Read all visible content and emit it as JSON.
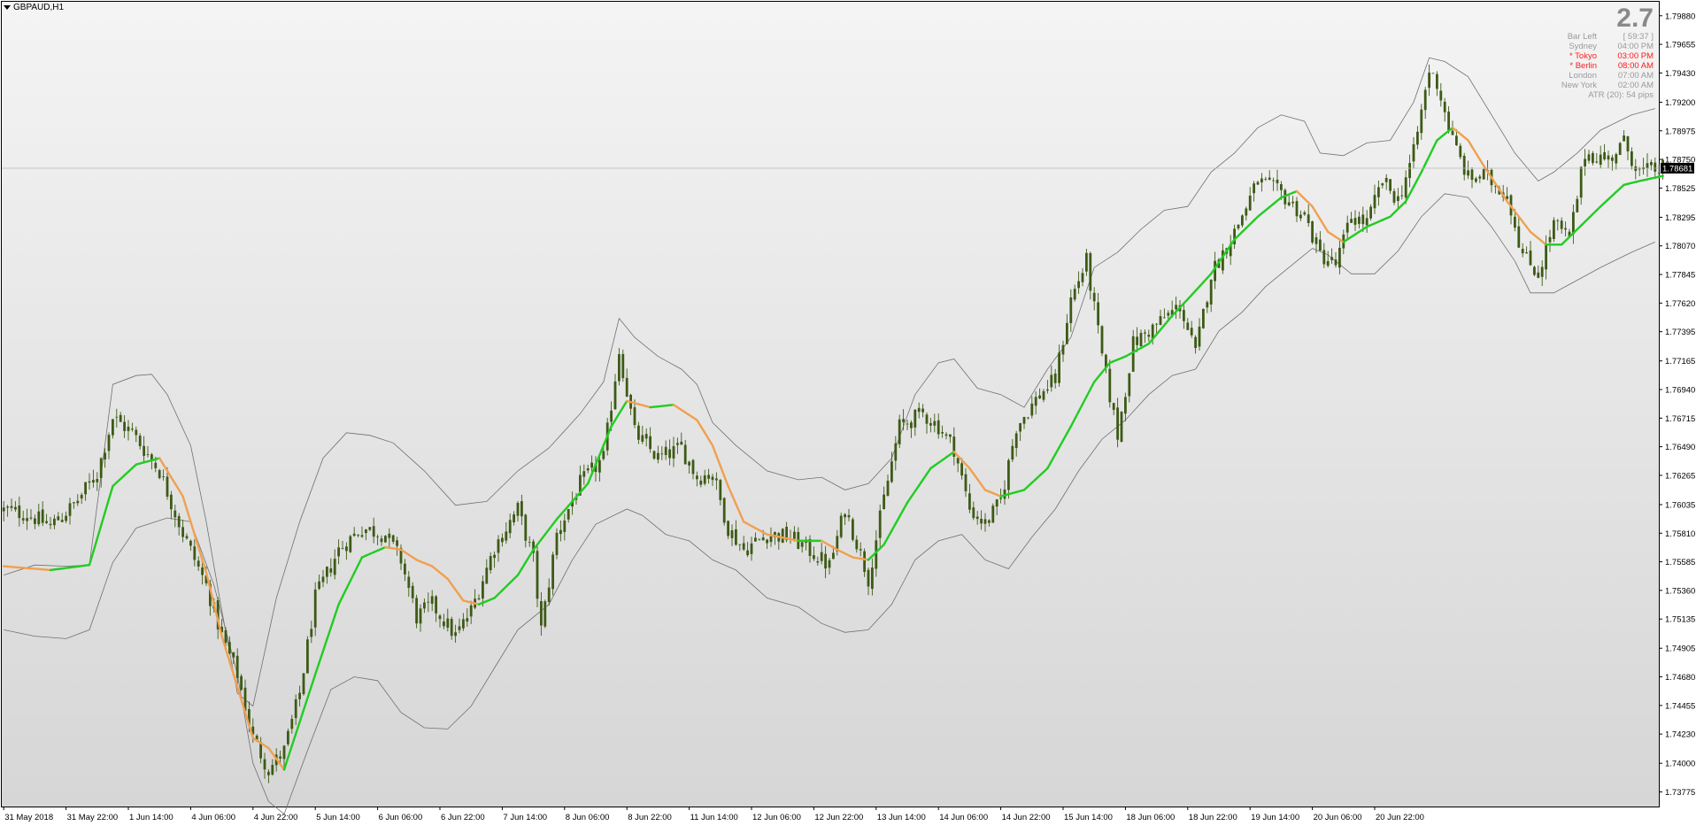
{
  "window": {
    "title": "GBPAUD,H1"
  },
  "info_panel": {
    "big_value": "2.7",
    "rows": [
      {
        "label": "Bar Left",
        "value": "[ 59:37 ]",
        "highlight": false
      },
      {
        "label": "Sydney",
        "value": "04:00 PM",
        "highlight": false
      },
      {
        "label": "* Tokyo",
        "value": "03:00 PM",
        "highlight": true
      },
      {
        "label": "* Berlin",
        "value": "08:00 AM",
        "highlight": true
      },
      {
        "label": "London",
        "value": "07:00 AM",
        "highlight": false
      },
      {
        "label": "New York",
        "value": "02:00 AM",
        "highlight": false
      }
    ],
    "atr": "ATR (20): 54 pips"
  },
  "colors": {
    "bg_top": "#f4f4f4",
    "bg_bottom": "#d6d6d6",
    "candle": "#3d5a16",
    "ma_up": "#22cc22",
    "ma_down": "#f0a050",
    "band": "#707070",
    "current_price_bg": "#000000"
  },
  "price_axis": {
    "labels": [
      "1.79880",
      "1.79655",
      "1.79430",
      "1.79200",
      "1.78975",
      "1.78750",
      "1.78525",
      "1.78295",
      "1.78070",
      "1.77845",
      "1.77620",
      "1.77395",
      "1.77165",
      "1.76940",
      "1.76715",
      "1.76490",
      "1.76265",
      "1.76035",
      "1.75810",
      "1.75585",
      "1.75360",
      "1.75135",
      "1.74905",
      "1.74680",
      "1.74455",
      "1.74230",
      "1.74000",
      "1.73775"
    ],
    "current_price": "1.78681"
  },
  "time_axis": {
    "labels": [
      "31 May 2018",
      "31 May 22:00",
      "1 Jun 14:00",
      "4 Jun 06:00",
      "4 Jun 22:00",
      "5 Jun 14:00",
      "6 Jun 06:00",
      "6 Jun 22:00",
      "7 Jun 14:00",
      "8 Jun 06:00",
      "8 Jun 22:00",
      "11 Jun 14:00",
      "12 Jun 06:00",
      "12 Jun 22:00",
      "13 Jun 14:00",
      "14 Jun 06:00",
      "14 Jun 22:00",
      "15 Jun 14:00",
      "18 Jun 06:00",
      "18 Jun 22:00",
      "19 Jun 14:00",
      "20 Jun 06:00",
      "20 Jun 22:00"
    ]
  },
  "chart_data": {
    "type": "candlestick",
    "symbol": "GBPAUD",
    "timeframe": "H1",
    "ylim": [
      1.7366,
      1.7999
    ],
    "current_price": 1.78681,
    "close_path": [
      [
        0,
        1.7599
      ],
      [
        6,
        1.7596
      ],
      [
        12,
        1.7587
      ],
      [
        18,
        1.7603
      ],
      [
        24,
        1.7628
      ],
      [
        28,
        1.7672
      ],
      [
        33,
        1.766
      ],
      [
        40,
        1.763
      ],
      [
        46,
        1.7581
      ],
      [
        52,
        1.754
      ],
      [
        56,
        1.75
      ],
      [
        60,
        1.747
      ],
      [
        64,
        1.742
      ],
      [
        68,
        1.7395
      ],
      [
        72,
        1.741
      ],
      [
        76,
        1.7455
      ],
      [
        80,
        1.753
      ],
      [
        86,
        1.7568
      ],
      [
        92,
        1.7585
      ],
      [
        98,
        1.758
      ],
      [
        102,
        1.756
      ],
      [
        106,
        1.7515
      ],
      [
        110,
        1.7525
      ],
      [
        116,
        1.75
      ],
      [
        120,
        1.752
      ],
      [
        126,
        1.757
      ],
      [
        132,
        1.76
      ],
      [
        136,
        1.756
      ],
      [
        138,
        1.7505
      ],
      [
        142,
        1.758
      ],
      [
        148,
        1.762
      ],
      [
        154,
        1.764
      ],
      [
        158,
        1.7725
      ],
      [
        162,
        1.766
      ],
      [
        168,
        1.764
      ],
      [
        174,
        1.7648
      ],
      [
        178,
        1.7625
      ],
      [
        182,
        1.7628
      ],
      [
        186,
        1.7585
      ],
      [
        190,
        1.7568
      ],
      [
        196,
        1.758
      ],
      [
        202,
        1.7578
      ],
      [
        208,
        1.7565
      ],
      [
        212,
        1.7555
      ],
      [
        216,
        1.76
      ],
      [
        220,
        1.7565
      ],
      [
        222,
        1.7545
      ],
      [
        226,
        1.7608
      ],
      [
        230,
        1.7665
      ],
      [
        236,
        1.7675
      ],
      [
        240,
        1.7665
      ],
      [
        244,
        1.7648
      ],
      [
        248,
        1.76
      ],
      [
        252,
        1.7588
      ],
      [
        256,
        1.7606
      ],
      [
        260,
        1.7665
      ],
      [
        266,
        1.769
      ],
      [
        270,
        1.7702
      ],
      [
        274,
        1.7765
      ],
      [
        278,
        1.7795
      ],
      [
        282,
        1.772
      ],
      [
        286,
        1.7658
      ],
      [
        290,
        1.773
      ],
      [
        296,
        1.7745
      ],
      [
        302,
        1.776
      ],
      [
        306,
        1.7722
      ],
      [
        310,
        1.7785
      ],
      [
        316,
        1.7818
      ],
      [
        322,
        1.7858
      ],
      [
        328,
        1.7848
      ],
      [
        334,
        1.783
      ],
      [
        338,
        1.78
      ],
      [
        342,
        1.7792
      ],
      [
        346,
        1.783
      ],
      [
        350,
        1.7825
      ],
      [
        354,
        1.7858
      ],
      [
        358,
        1.7843
      ],
      [
        362,
        1.788
      ],
      [
        366,
        1.7945
      ],
      [
        368,
        1.7935
      ],
      [
        372,
        1.789
      ],
      [
        376,
        1.786
      ],
      [
        380,
        1.7862
      ],
      [
        386,
        1.7848
      ],
      [
        390,
        1.78
      ],
      [
        394,
        1.7785
      ],
      [
        398,
        1.7825
      ],
      [
        402,
        1.7812
      ],
      [
        406,
        1.788
      ],
      [
        412,
        1.7875
      ],
      [
        416,
        1.7888
      ],
      [
        420,
        1.7865
      ],
      [
        426,
        1.7868
      ]
    ],
    "ma_path": [
      [
        0,
        1.7555
      ],
      [
        12,
        1.7552
      ],
      [
        22,
        1.7556
      ],
      [
        28,
        1.7618
      ],
      [
        34,
        1.7635
      ],
      [
        40,
        1.764
      ],
      [
        46,
        1.761
      ],
      [
        52,
        1.755
      ],
      [
        56,
        1.75
      ],
      [
        60,
        1.746
      ],
      [
        64,
        1.742
      ],
      [
        68,
        1.7412
      ],
      [
        72,
        1.7395
      ],
      [
        80,
        1.747
      ],
      [
        86,
        1.7525
      ],
      [
        92,
        1.7562
      ],
      [
        98,
        1.757
      ],
      [
        102,
        1.7568
      ],
      [
        106,
        1.756
      ],
      [
        110,
        1.7555
      ],
      [
        114,
        1.7545
      ],
      [
        118,
        1.7528
      ],
      [
        122,
        1.7525
      ],
      [
        126,
        1.753
      ],
      [
        132,
        1.7548
      ],
      [
        136,
        1.7568
      ],
      [
        142,
        1.7592
      ],
      [
        150,
        1.762
      ],
      [
        156,
        1.7665
      ],
      [
        160,
        1.7685
      ],
      [
        166,
        1.768
      ],
      [
        172,
        1.7682
      ],
      [
        178,
        1.767
      ],
      [
        182,
        1.765
      ],
      [
        186,
        1.7618
      ],
      [
        190,
        1.759
      ],
      [
        196,
        1.758
      ],
      [
        204,
        1.7575
      ],
      [
        210,
        1.7575
      ],
      [
        214,
        1.7568
      ],
      [
        218,
        1.7562
      ],
      [
        222,
        1.756
      ],
      [
        226,
        1.7572
      ],
      [
        232,
        1.7605
      ],
      [
        238,
        1.7632
      ],
      [
        244,
        1.7645
      ],
      [
        248,
        1.7632
      ],
      [
        252,
        1.7615
      ],
      [
        256,
        1.761
      ],
      [
        262,
        1.7615
      ],
      [
        268,
        1.7632
      ],
      [
        274,
        1.7665
      ],
      [
        280,
        1.77
      ],
      [
        284,
        1.7715
      ],
      [
        288,
        1.772
      ],
      [
        294,
        1.773
      ],
      [
        300,
        1.7752
      ],
      [
        304,
        1.7765
      ],
      [
        310,
        1.7785
      ],
      [
        316,
        1.7812
      ],
      [
        322,
        1.783
      ],
      [
        328,
        1.7845
      ],
      [
        332,
        1.785
      ],
      [
        336,
        1.7838
      ],
      [
        340,
        1.7818
      ],
      [
        344,
        1.781
      ],
      [
        350,
        1.7822
      ],
      [
        356,
        1.783
      ],
      [
        360,
        1.7842
      ],
      [
        364,
        1.7865
      ],
      [
        368,
        1.789
      ],
      [
        372,
        1.79
      ],
      [
        376,
        1.789
      ],
      [
        380,
        1.787
      ],
      [
        386,
        1.7842
      ],
      [
        392,
        1.7818
      ],
      [
        396,
        1.7808
      ],
      [
        400,
        1.7808
      ],
      [
        404,
        1.782
      ],
      [
        410,
        1.7838
      ],
      [
        416,
        1.7855
      ],
      [
        420,
        1.7858
      ],
      [
        426,
        1.7862
      ]
    ],
    "band_upper_path": [
      [
        0,
        1.7548
      ],
      [
        8,
        1.7556
      ],
      [
        16,
        1.7555
      ],
      [
        22,
        1.7556
      ],
      [
        28,
        1.7698
      ],
      [
        34,
        1.7705
      ],
      [
        38,
        1.7706
      ],
      [
        42,
        1.769
      ],
      [
        48,
        1.765
      ],
      [
        52,
        1.759
      ],
      [
        56,
        1.752
      ],
      [
        60,
        1.7455
      ],
      [
        64,
        1.7445
      ],
      [
        70,
        1.753
      ],
      [
        76,
        1.759
      ],
      [
        82,
        1.764
      ],
      [
        88,
        1.766
      ],
      [
        94,
        1.7658
      ],
      [
        100,
        1.7652
      ],
      [
        108,
        1.763
      ],
      [
        116,
        1.7603
      ],
      [
        124,
        1.7606
      ],
      [
        132,
        1.763
      ],
      [
        140,
        1.7648
      ],
      [
        148,
        1.7675
      ],
      [
        154,
        1.77
      ],
      [
        158,
        1.775
      ],
      [
        162,
        1.7735
      ],
      [
        168,
        1.772
      ],
      [
        174,
        1.771
      ],
      [
        178,
        1.7698
      ],
      [
        182,
        1.7668
      ],
      [
        188,
        1.765
      ],
      [
        196,
        1.763
      ],
      [
        204,
        1.7623
      ],
      [
        210,
        1.7625
      ],
      [
        216,
        1.7615
      ],
      [
        222,
        1.762
      ],
      [
        228,
        1.764
      ],
      [
        234,
        1.769
      ],
      [
        240,
        1.7715
      ],
      [
        244,
        1.7718
      ],
      [
        250,
        1.7695
      ],
      [
        256,
        1.769
      ],
      [
        262,
        1.768
      ],
      [
        268,
        1.771
      ],
      [
        274,
        1.7735
      ],
      [
        280,
        1.779
      ],
      [
        286,
        1.7802
      ],
      [
        292,
        1.782
      ],
      [
        298,
        1.7835
      ],
      [
        304,
        1.7838
      ],
      [
        310,
        1.7865
      ],
      [
        316,
        1.788
      ],
      [
        322,
        1.79
      ],
      [
        328,
        1.791
      ],
      [
        334,
        1.7905
      ],
      [
        338,
        1.788
      ],
      [
        344,
        1.7878
      ],
      [
        350,
        1.7888
      ],
      [
        356,
        1.789
      ],
      [
        362,
        1.792
      ],
      [
        366,
        1.7955
      ],
      [
        370,
        1.7952
      ],
      [
        376,
        1.794
      ],
      [
        382,
        1.791
      ],
      [
        388,
        1.788
      ],
      [
        394,
        1.7858
      ],
      [
        398,
        1.7865
      ],
      [
        404,
        1.788
      ],
      [
        410,
        1.7898
      ],
      [
        418,
        1.791
      ],
      [
        424,
        1.7915
      ]
    ],
    "band_lower_path": [
      [
        0,
        1.7505
      ],
      [
        8,
        1.75
      ],
      [
        16,
        1.7498
      ],
      [
        22,
        1.7505
      ],
      [
        28,
        1.7558
      ],
      [
        34,
        1.7585
      ],
      [
        42,
        1.7593
      ],
      [
        48,
        1.759
      ],
      [
        54,
        1.754
      ],
      [
        60,
        1.747
      ],
      [
        64,
        1.74
      ],
      [
        68,
        1.737
      ],
      [
        72,
        1.736
      ],
      [
        78,
        1.741
      ],
      [
        84,
        1.7458
      ],
      [
        90,
        1.7468
      ],
      [
        96,
        1.7465
      ],
      [
        102,
        1.744
      ],
      [
        108,
        1.7428
      ],
      [
        114,
        1.7427
      ],
      [
        120,
        1.7445
      ],
      [
        126,
        1.7475
      ],
      [
        132,
        1.7505
      ],
      [
        140,
        1.7525
      ],
      [
        146,
        1.756
      ],
      [
        152,
        1.7588
      ],
      [
        160,
        1.76
      ],
      [
        164,
        1.7595
      ],
      [
        170,
        1.758
      ],
      [
        176,
        1.7575
      ],
      [
        182,
        1.756
      ],
      [
        188,
        1.7552
      ],
      [
        196,
        1.753
      ],
      [
        204,
        1.7523
      ],
      [
        210,
        1.751
      ],
      [
        216,
        1.7503
      ],
      [
        222,
        1.7505
      ],
      [
        228,
        1.7525
      ],
      [
        234,
        1.756
      ],
      [
        240,
        1.7575
      ],
      [
        246,
        1.758
      ],
      [
        252,
        1.756
      ],
      [
        258,
        1.7553
      ],
      [
        264,
        1.7578
      ],
      [
        270,
        1.76
      ],
      [
        276,
        1.763
      ],
      [
        282,
        1.7655
      ],
      [
        288,
        1.767
      ],
      [
        294,
        1.769
      ],
      [
        300,
        1.7705
      ],
      [
        306,
        1.771
      ],
      [
        312,
        1.774
      ],
      [
        318,
        1.7755
      ],
      [
        324,
        1.7775
      ],
      [
        330,
        1.779
      ],
      [
        336,
        1.7805
      ],
      [
        340,
        1.78
      ],
      [
        346,
        1.7785
      ],
      [
        352,
        1.7785
      ],
      [
        358,
        1.7803
      ],
      [
        364,
        1.783
      ],
      [
        370,
        1.7848
      ],
      [
        376,
        1.7845
      ],
      [
        382,
        1.7822
      ],
      [
        388,
        1.7795
      ],
      [
        392,
        1.777
      ],
      [
        398,
        1.777
      ],
      [
        404,
        1.778
      ],
      [
        410,
        1.779
      ],
      [
        418,
        1.7802
      ],
      [
        424,
        1.781
      ]
    ]
  }
}
